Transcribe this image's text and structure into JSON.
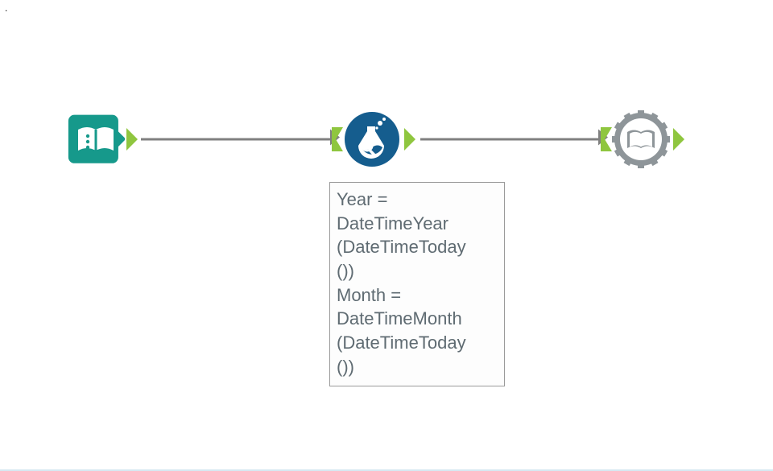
{
  "workflow": {
    "nodes": {
      "input": {
        "name": "input-data-tool",
        "icon": "open-book-icon",
        "color": "#16998b",
        "interactable": true
      },
      "formula": {
        "name": "formula-tool",
        "icon": "flask-icon",
        "color": "#155d8e",
        "interactable": true
      },
      "output": {
        "name": "browse-tool",
        "icon": "gear-book-icon",
        "color": "#8e9599",
        "interactable": true
      }
    },
    "connections": [
      {
        "from": "input",
        "to": "formula"
      },
      {
        "from": "formula",
        "to": "output"
      }
    ],
    "formula_config": {
      "lines": [
        "Year =",
        "DateTimeYear",
        "(DateTimeToday",
        "())",
        "Month =",
        "DateTimeMonth",
        "(DateTimeToday",
        "())"
      ]
    }
  },
  "colors": {
    "anchor_green": "#8fc63f",
    "connector_grey": "#808080",
    "annot_border": "#9a9a9a",
    "annot_text": "#5f6b72"
  }
}
